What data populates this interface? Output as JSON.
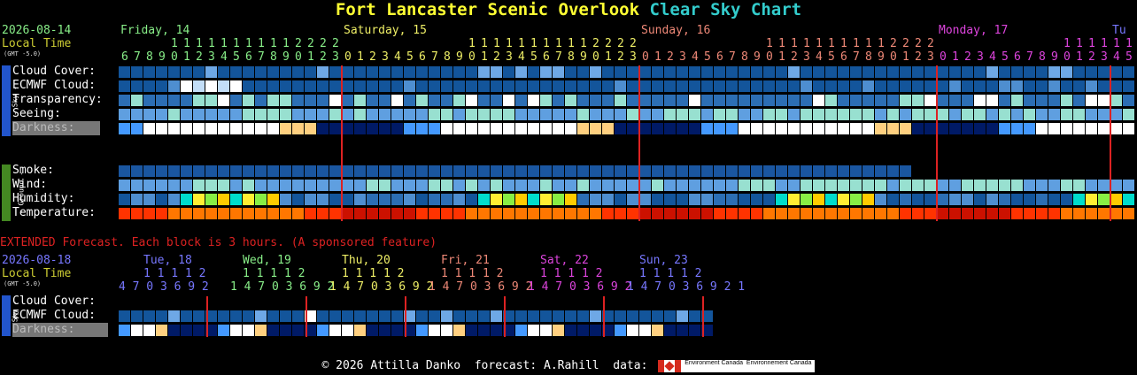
{
  "title": {
    "location": "Fort Lancaster Scenic Overlook",
    "clear": "Clear",
    "sky_chart": "Sky Chart"
  },
  "main": {
    "date": "2026-08-14",
    "local_time": "Local Time",
    "gmt": "(GMT -5.0)",
    "days": [
      {
        "label": "Friday, 14",
        "color": "#88ee88"
      },
      {
        "label": "Saturday, 15",
        "color": "#eeee66"
      },
      {
        "label": "Sunday, 16",
        "color": "#ee8877"
      },
      {
        "label": "Monday, 17",
        "color": "#dd44dd"
      },
      {
        "label": "Tu",
        "color": "#7777ff"
      }
    ],
    "hour_start": 6,
    "hour_count": 82,
    "sky_tab": "- Sky -",
    "ground_tab": "- Ground -",
    "rows": {
      "cloud": "Cloud Cover:",
      "ecmwf": "ECMWF Cloud:",
      "transparency": "Transparency:",
      "seeing": "Seeing:",
      "darkness": "Darkness:",
      "smoke": "Smoke:",
      "wind": "Wind:",
      "humidity": "Humidity:",
      "temperature": "Temperature:"
    }
  },
  "extended": {
    "note": "EXTENDED Forecast. Each block is 3 hours. (A sponsored feature)",
    "date": "2026-08-18",
    "local_time": "Local Time",
    "gmt": "(GMT -5.0)",
    "days": [
      {
        "label": "Tue, 18",
        "color": "#7777ff",
        "top": "1 1 1 1 2",
        "bottom": "4 7 0 3 6 9 2"
      },
      {
        "label": "Wed, 19",
        "color": "#88ee88",
        "top": "1 1 1 1 2",
        "bottom": "1 4 7 0 3 6 9 2"
      },
      {
        "label": "Thu, 20",
        "color": "#eeee66",
        "top": "1 1 1 1 2",
        "bottom": "1 4 7 0 3 6 9 2"
      },
      {
        "label": "Fri, 21",
        "color": "#ee8877",
        "top": "1 1 1 1 2",
        "bottom": "1 4 7 0 3 6 9 2"
      },
      {
        "label": "Sat, 22",
        "color": "#dd44dd",
        "top": "1 1 1 1 2",
        "bottom": "1 4 7 0 3 6 9 2"
      },
      {
        "label": "Sun, 23",
        "color": "#7777ff",
        "top": "1 1 1 1 2",
        "bottom": "1 4 7 0 3 6 9 2 1"
      }
    ],
    "rows": {
      "cloud": "Cloud Cover:",
      "ecmwf": "ECMWF Cloud:",
      "darkness": "Darkness:"
    },
    "sky_tab": "- Sky -"
  },
  "footer": {
    "copyright": "© 2026 Attilla Danko",
    "forecast": "forecast: A.Rahill",
    "data": "data:",
    "env1": "Environment Canada",
    "env2": "Environnement Canada"
  },
  "colors": {
    "clear": "#003d7e",
    "cloud_dark": "#13559b",
    "cloud_mid": "#2c6eb4",
    "cloud_light": "#5f9fe0",
    "overcast": "#ffffff",
    "excellent": "#1a56a0",
    "good": "#98e0d0",
    "poor": "#f0f0e0",
    "midnight_line": "#dd2222"
  }
}
